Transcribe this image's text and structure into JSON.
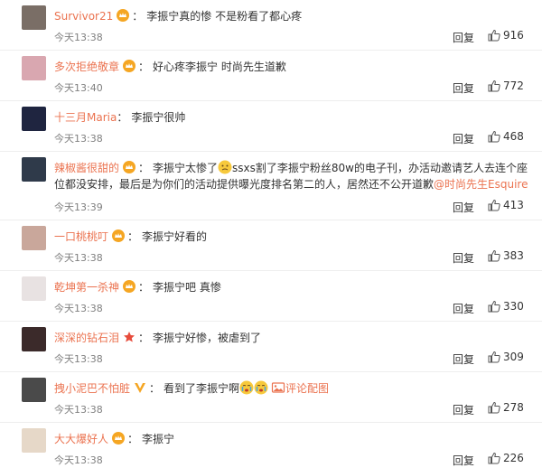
{
  "comments": [
    {
      "username": "Survivor21",
      "text": "李振宁真的惨 不是粉看了都心疼",
      "time": "今天13:38",
      "reply_label": "回复",
      "likes": "916",
      "badge": "crown",
      "avatar_color": "#7a6e66"
    },
    {
      "username": "多次拒绝敬章",
      "text": "好心疼李振宁 时尚先生道歉",
      "time": "今天13:40",
      "reply_label": "回复",
      "likes": "772",
      "badge": "crown",
      "avatar_color": "#d9a7b0"
    },
    {
      "username": "十三月Maria",
      "text": "李振宁很帅",
      "time": "今天13:38",
      "reply_label": "回复",
      "likes": "468",
      "badge": "none",
      "avatar_color": "#1f2540"
    },
    {
      "username": "辣椒酱很甜的",
      "text_a": "李振宁太惨了",
      "text_b": "ssxs割了李振宁粉丝80w的电子刊，办活动邀请艺人去连个座位都没安排，最后是为你们的活动提供曝光度排名第二的人，居然还不公开道歉",
      "mention": "@时尚先生Esquire",
      "time": "今天13:39",
      "reply_label": "回复",
      "likes": "413",
      "badge": "crown",
      "avatar_color": "#2f3a4a"
    },
    {
      "username": "一口桃桃叮",
      "text": "李振宁好看的",
      "time": "今天13:38",
      "reply_label": "回复",
      "likes": "383",
      "badge": "crown",
      "avatar_color": "#c9a79b"
    },
    {
      "username": "乾坤第一杀神",
      "text": "李振宁吧 真惨",
      "time": "今天13:38",
      "reply_label": "回复",
      "likes": "330",
      "badge": "crown",
      "avatar_color": "#e8e2e2"
    },
    {
      "username": "深深的钻石泪",
      "text": "李振宁好惨，被虐到了",
      "time": "今天13:38",
      "reply_label": "回复",
      "likes": "309",
      "badge": "star",
      "avatar_color": "#3b2a2a"
    },
    {
      "username": "拽小泥巴不怕脏",
      "text": "看到了李振宁啊",
      "extra_link": "评论配图",
      "time": "今天13:38",
      "reply_label": "回复",
      "likes": "278",
      "badge": "vip",
      "avatar_color": "#4a4a4a"
    },
    {
      "username": "大大爆好人",
      "text": "李振宁",
      "time": "今天13:38",
      "reply_label": "回复",
      "likes": "226",
      "badge": "crown",
      "avatar_color": "#e6d8c8"
    }
  ],
  "colors": {
    "username": "#eb7350",
    "time": "#808080",
    "divider": "#eeeeee"
  },
  "icons": {
    "like": "thumb-up-icon",
    "crown": "crown-badge-icon",
    "star": "star-badge-icon",
    "vip": "vip-badge-icon"
  }
}
